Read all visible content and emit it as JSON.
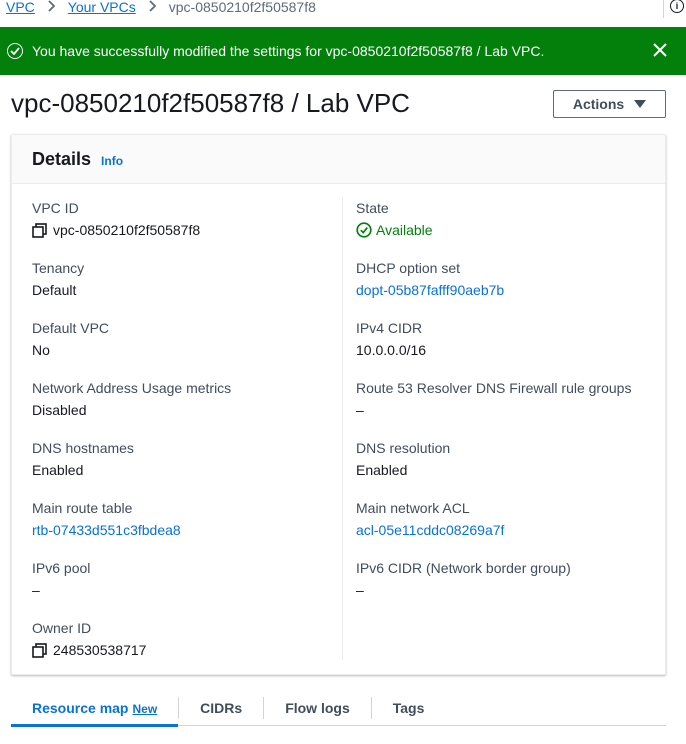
{
  "breadcrumb": {
    "items": [
      "VPC",
      "Your VPCs"
    ],
    "current": "vpc-0850210f2f50587f8"
  },
  "flash": {
    "message": "You have successfully modified the settings for vpc-0850210f2f50587f8 / Lab VPC."
  },
  "page": {
    "title": "vpc-0850210f2f50587f8 / Lab VPC",
    "actions_label": "Actions"
  },
  "details": {
    "title": "Details",
    "info_label": "Info",
    "left": [
      {
        "label": "VPC ID",
        "value": "vpc-0850210f2f50587f8",
        "type": "copy"
      },
      {
        "label": "Tenancy",
        "value": "Default",
        "type": "text"
      },
      {
        "label": "Default VPC",
        "value": "No",
        "type": "text"
      },
      {
        "label": "Network Address Usage metrics",
        "value": "Disabled",
        "type": "text"
      },
      {
        "label": "DNS hostnames",
        "value": "Enabled",
        "type": "text"
      },
      {
        "label": "Main route table",
        "value": "rtb-07433d551c3fbdea8",
        "type": "link"
      },
      {
        "label": "IPv6 pool",
        "value": "–",
        "type": "text"
      },
      {
        "label": "Owner ID",
        "value": "248530538717",
        "type": "copy"
      }
    ],
    "right": [
      {
        "label": "State",
        "value": "Available",
        "type": "status"
      },
      {
        "label": "DHCP option set",
        "value": "dopt-05b87fafff90aeb7b",
        "type": "link"
      },
      {
        "label": "IPv4 CIDR",
        "value": "10.0.0.0/16",
        "type": "text"
      },
      {
        "label": "Route 53 Resolver DNS Firewall rule groups",
        "value": "–",
        "type": "text"
      },
      {
        "label": "DNS resolution",
        "value": "Enabled",
        "type": "text"
      },
      {
        "label": "Main network ACL",
        "value": "acl-05e11cddc08269a7f",
        "type": "link"
      },
      {
        "label": "IPv6 CIDR (Network border group)",
        "value": "–",
        "type": "text"
      }
    ]
  },
  "tabs": [
    {
      "label": "Resource map",
      "badge": "New",
      "active": true
    },
    {
      "label": "CIDRs"
    },
    {
      "label": "Flow logs"
    },
    {
      "label": "Tags"
    }
  ],
  "colors": {
    "success": "#037f0c",
    "link": "#0972d3",
    "text": "#16191f"
  }
}
